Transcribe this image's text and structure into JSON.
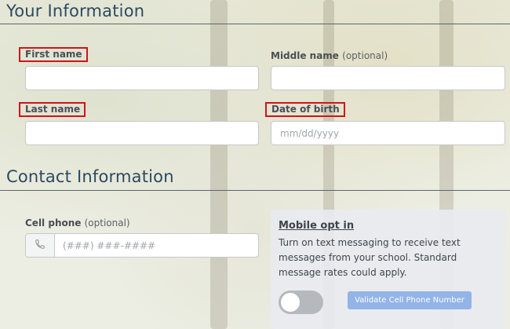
{
  "your_info": {
    "heading": "Your Information",
    "first_name_label": "First name",
    "middle_name_label": "Middle name",
    "middle_name_optional": "(optional)",
    "last_name_label": "Last name",
    "dob_label": "Date of birth",
    "dob_placeholder": "mm/dd/yyyy"
  },
  "contact_info": {
    "heading": "Contact Information",
    "cell_label": "Cell phone",
    "cell_optional": "(optional)",
    "cell_placeholder": "(###) ###-####",
    "mobile_opt_in": {
      "title": "Mobile opt in",
      "description": "Turn on text messaging to receive text messages from your school. Standard message rates could apply.",
      "toggle_on": false,
      "validate_button": "Validate Cell Phone Number"
    }
  },
  "colors": {
    "highlight_box": "#d0141b",
    "heading": "#2c4a60",
    "button": "#93b4e6"
  },
  "icons": [
    "phone-icon"
  ]
}
